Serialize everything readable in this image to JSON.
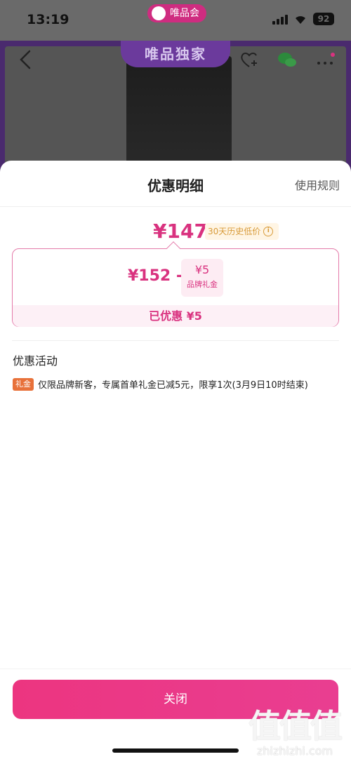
{
  "status_bar": {
    "time": "13:19",
    "brand_label": "唯品会",
    "battery": "92"
  },
  "product": {
    "banner": "唯品独家"
  },
  "sheet": {
    "title": "优惠明细",
    "rules_link": "使用规则",
    "final_price": "¥147",
    "low_price_badge": "30天历史低价",
    "original_price": "¥152 -",
    "discount": {
      "amount": "¥5",
      "label": "品牌礼金"
    },
    "saved_text": "已优惠 ¥5",
    "section_title": "优惠活动",
    "promotions": [
      {
        "tag": "礼金",
        "text": "仅限品牌新客，专属首单礼金已减5元，限享1次(3月9日10时结束)"
      }
    ],
    "close_button": "关闭"
  },
  "watermark": {
    "chars": "值值值",
    "domain": "zhizhizhi.com"
  },
  "colors": {
    "accent": "#d9327f",
    "button": "#ec3580",
    "badge_bg": "#fff5e4",
    "tag": "#e8713a"
  }
}
